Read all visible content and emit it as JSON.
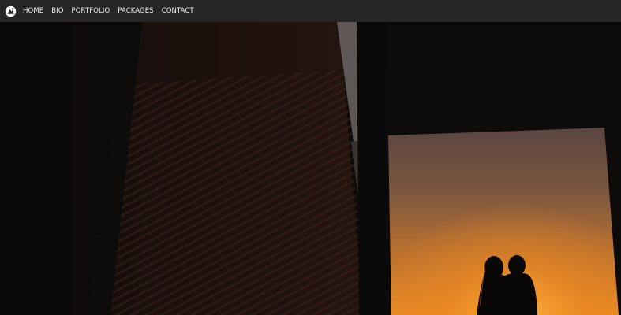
{
  "nav": {
    "logo_icon": "camera-logo-icon",
    "items": [
      {
        "label": "HOME"
      },
      {
        "label": "BIO"
      },
      {
        "label": "PORTFOLIO"
      },
      {
        "label": "PACKAGES"
      },
      {
        "label": "CONTACT"
      }
    ]
  },
  "hero": {
    "image": "sunset-couple-silhouette-photo",
    "colors": {
      "sky_top": "#6b4f45",
      "sky_mid": "#b8743a",
      "sky_glow": "#f39a2a",
      "shadow": "#0d0b0a",
      "wall": "#1c110e"
    }
  }
}
